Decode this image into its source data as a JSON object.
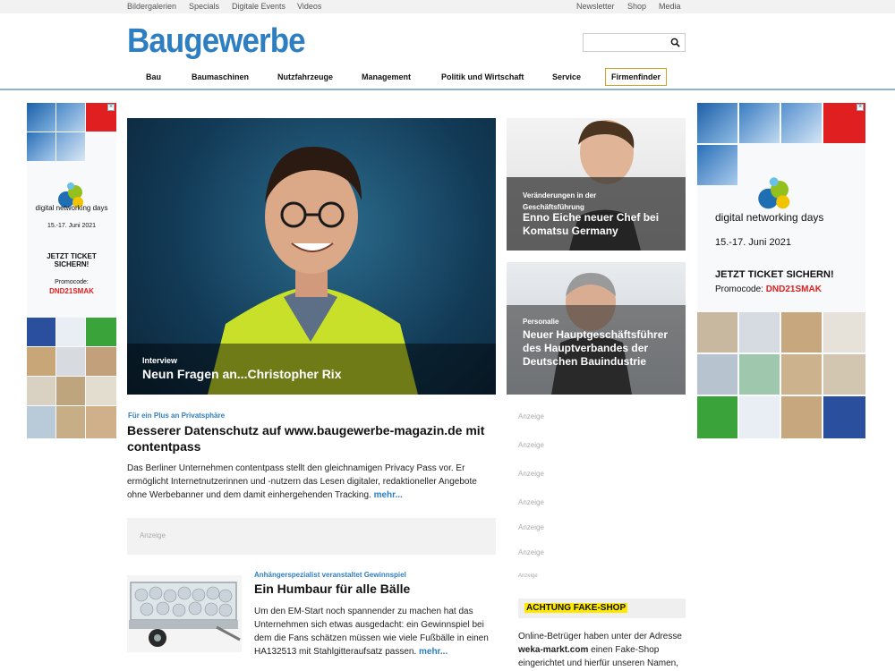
{
  "topbar": {
    "left": [
      "Bildergalerien",
      "Specials",
      "Digitale Events",
      "Videos"
    ],
    "right": [
      "Newsletter",
      "Shop",
      "Media"
    ]
  },
  "logo": "Baugewerbe",
  "search": {
    "placeholder": "",
    "icon": "search-icon"
  },
  "nav": [
    "Bau",
    "Baumaschinen",
    "Nutzfahrzeuge",
    "Management",
    "Politik und Wirtschaft",
    "Service",
    "Firmenfinder"
  ],
  "ad_left": {
    "title": "digital networking days",
    "date": "15.-17. Juni 2021",
    "cta": "JETZT TICKET SICHERN!",
    "promo_label": "Promocode:",
    "promo_code": "DND21SMAK"
  },
  "ad_right": {
    "title": "digital networking days",
    "date": "15.-17. Juni 2021",
    "cta": "JETZT TICKET SICHERN!",
    "promo_label": "Promocode:",
    "promo_code": "DND21SMAK"
  },
  "hero": {
    "kicker": "Interview",
    "title": "Neun Fragen an...Christopher Rix"
  },
  "side_cards": [
    {
      "kicker": "Veränderungen in der Geschäftsführung",
      "title": "Enno Eiche neuer Chef bei Komatsu Germany"
    },
    {
      "kicker": "Personalie",
      "title": "Neuer Hauptgeschäftsführer des Hauptverbandes der Deutschen Bauindustrie"
    }
  ],
  "article1": {
    "kicker": "Für ein Plus an Privatsphäre",
    "title": "Besserer Datenschutz auf www.baugewerbe-magazin.de mit contentpass",
    "body": "Das Berliner Unternehmen contentpass stellt den gleichnamigen Privacy Pass vor. Er ermöglicht Internetnutzerinnen und -nutzern das Lesen digitaler, redaktioneller Angebote ohne Werbebanner und dem damit einhergehenden Tracking.",
    "more": "mehr..."
  },
  "ad_label": "Anzeige",
  "article2": {
    "kicker": "Anhängerspezialist veranstaltet Gewinnspiel",
    "title": "Ein Humbaur für alle Bälle",
    "body": "Um den EM-Start noch spannender zu machen hat das Unternehmen sich etwas ausgedacht: ein Gewinnspiel bei dem die Fans schätzen müssen wie viele Fußbälle in einen HA132513 mit Stahlgitteraufsatz passen.",
    "more": "mehr..."
  },
  "right_col": {
    "anzeige_labels": [
      "Anzeige",
      "Anzeige",
      "Anzeige",
      "Anzeige",
      "Anzeige",
      "Anzeige",
      "Anzeige"
    ],
    "fake_shop_title": "ACHTUNG FAKE-SHOP",
    "fake_shop_text_1": "Online-Betrüger haben unter der Adresse",
    "fake_shop_domain": "weka-markt.com",
    "fake_shop_text_2": " einen Fake-Shop eingerichtet und hierfür unseren Namen,"
  },
  "colors": {
    "brand_blue": "#2d7fc1",
    "promo_red": "#e02020",
    "highlight_yellow": "#ffe900"
  }
}
